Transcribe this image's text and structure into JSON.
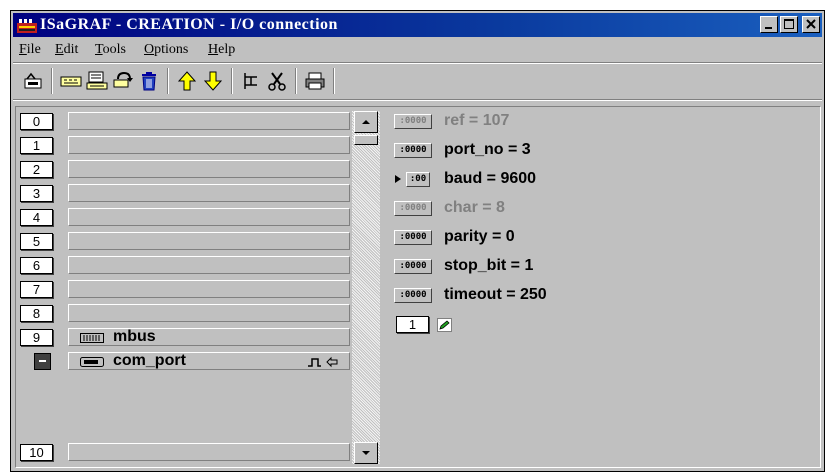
{
  "window": {
    "title": "ISaGRAF - CREATION - I/O connection",
    "controls": [
      "minimize",
      "maximize",
      "close"
    ]
  },
  "menu": [
    {
      "label": "File",
      "accel": "F",
      "rest": "ile"
    },
    {
      "label": "Edit",
      "accel": "E",
      "rest": "dit"
    },
    {
      "label": "Tools",
      "accel": "T",
      "rest": "ools"
    },
    {
      "label": "Options",
      "accel": "O",
      "rest": "ptions"
    },
    {
      "label": "Help",
      "accel": "H",
      "rest": "elp"
    }
  ],
  "toolbar": {
    "icons": [
      "open-icon",
      "board-icon",
      "disk-board-icon",
      "refresh-icon",
      "delete-icon",
      "arrow-up-icon",
      "arrow-down-icon",
      "tree-icon",
      "cut-icon",
      "print-icon"
    ]
  },
  "slots": [
    {
      "num": "0"
    },
    {
      "num": "1"
    },
    {
      "num": "2"
    },
    {
      "num": "3"
    },
    {
      "num": "4"
    },
    {
      "num": "5"
    },
    {
      "num": "6"
    },
    {
      "num": "7"
    },
    {
      "num": "8"
    },
    {
      "num": "9",
      "label": "mbus"
    },
    {
      "num": "-",
      "label": "com_port"
    },
    {
      "num": "10"
    }
  ],
  "params": [
    {
      "icon_text": ":0000",
      "text": "ref = 107",
      "disabled": true
    },
    {
      "icon_text": ":0000",
      "text": "port_no = 3"
    },
    {
      "icon_text": ":00",
      "text": "baud = 9600",
      "selected": true
    },
    {
      "icon_text": ":0000",
      "text": "char = 8",
      "disabled": true
    },
    {
      "icon_text": ":0000",
      "text": "parity = 0"
    },
    {
      "icon_text": ":0000",
      "text": "stop_bit = 1"
    },
    {
      "icon_text": ":0000",
      "text": "timeout = 250"
    }
  ],
  "channel": {
    "num": "1"
  },
  "colors": {
    "title_bar": "#000080",
    "face": "#c0c0c0",
    "disabled_text": "#808080"
  }
}
